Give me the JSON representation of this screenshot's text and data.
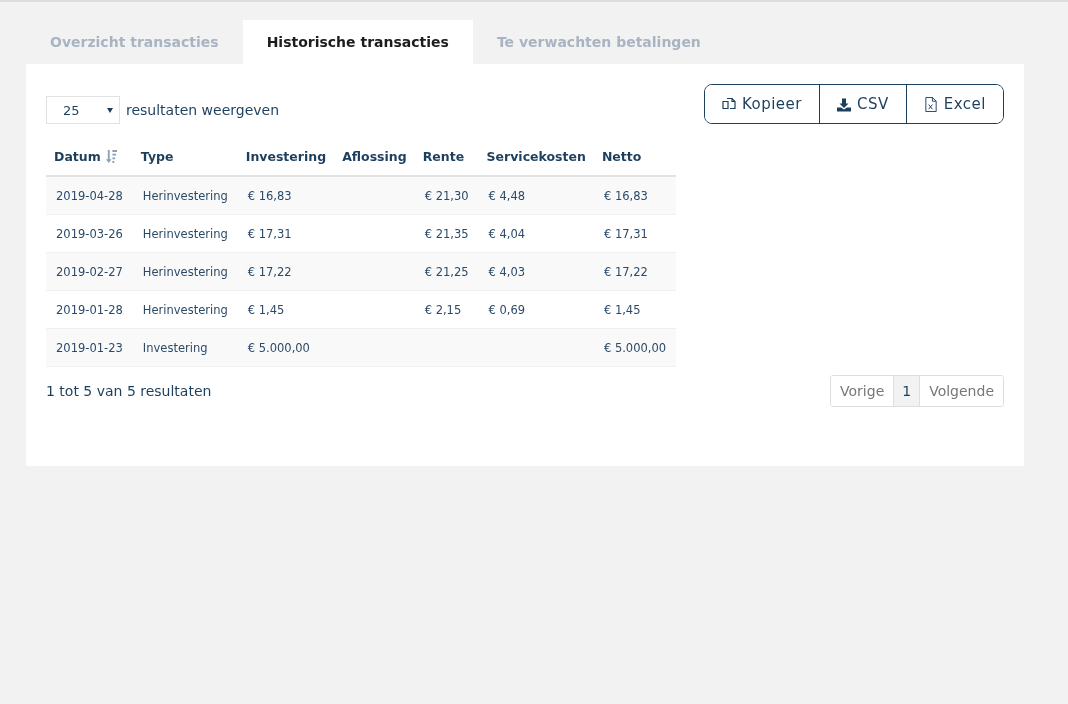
{
  "tabs": [
    {
      "label": "Overzicht transacties",
      "selected": false
    },
    {
      "label": "Historische transacties",
      "selected": true
    },
    {
      "label": "Te verwachten betalingen",
      "selected": false
    }
  ],
  "length_select": {
    "value": "25",
    "label": "resultaten weergeven"
  },
  "export_buttons": [
    {
      "kind": "copy",
      "label": "Kopieer"
    },
    {
      "kind": "csv",
      "label": "CSV"
    },
    {
      "kind": "excel",
      "label": "Excel"
    }
  ],
  "table": {
    "columns": [
      {
        "label": "Datum",
        "sorted": true
      },
      {
        "label": "Type",
        "sorted": false
      },
      {
        "label": "Investering",
        "sorted": false
      },
      {
        "label": "Aflossing",
        "sorted": false
      },
      {
        "label": "Rente",
        "sorted": false
      },
      {
        "label": "Servicekosten",
        "sorted": false
      },
      {
        "label": "Netto",
        "sorted": false
      }
    ],
    "rows": [
      [
        "2019-04-28",
        "Herinvestering",
        "€ 16,83",
        "",
        "€ 21,30",
        "€ 4,48",
        "€ 16,83"
      ],
      [
        "2019-03-26",
        "Herinvestering",
        "€ 17,31",
        "",
        "€ 21,35",
        "€ 4,04",
        "€ 17,31"
      ],
      [
        "2019-02-27",
        "Herinvestering",
        "€ 17,22",
        "",
        "€ 21,25",
        "€ 4,03",
        "€ 17,22"
      ],
      [
        "2019-01-28",
        "Herinvestering",
        "€ 1,45",
        "",
        "€ 2,15",
        "€ 0,69",
        "€ 1,45"
      ],
      [
        "2019-01-23",
        "Investering",
        "€ 5.000,00",
        "",
        "",
        "",
        "€ 5.000,00"
      ]
    ]
  },
  "info": "1 tot 5 van 5 resultaten",
  "pagination": [
    {
      "label": "Vorige",
      "selected": false
    },
    {
      "label": "1",
      "selected": true
    },
    {
      "label": "Volgende",
      "selected": false
    }
  ]
}
